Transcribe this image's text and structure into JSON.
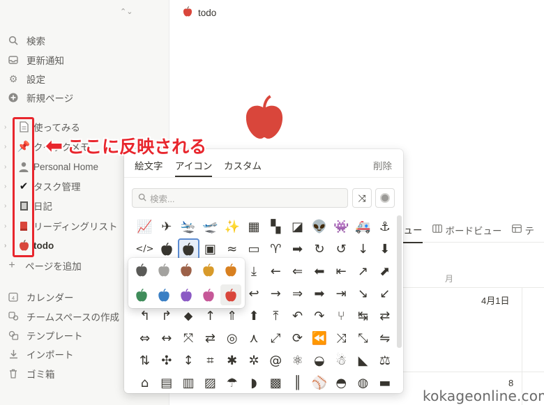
{
  "sidebar": {
    "workspace_switch_icon": "chevron-updown-icon",
    "nav": [
      {
        "label": "検索",
        "icon": "search-icon"
      },
      {
        "label": "更新通知",
        "icon": "inbox-icon"
      },
      {
        "label": "設定",
        "icon": "gear-icon"
      },
      {
        "label": "新規ページ",
        "icon": "plus-circle-icon"
      }
    ],
    "pages": [
      {
        "label": "使ってみる",
        "icon": "document-icon"
      },
      {
        "label": "クイックメモ",
        "icon": "pushpin-icon"
      },
      {
        "label": "Personal Home",
        "icon": "person-icon"
      },
      {
        "label": "タスク管理",
        "icon": "checkmark-icon"
      },
      {
        "label": "日記",
        "icon": "notebook-icon"
      },
      {
        "label": "リーディングリスト",
        "icon": "red-book-icon"
      },
      {
        "label": "todo",
        "icon": "apple-icon"
      }
    ],
    "add_page": "ページを追加",
    "footer": [
      {
        "label": "カレンダー",
        "icon": "calendar-icon"
      },
      {
        "label": "チームスペースの作成",
        "icon": "team-icon"
      },
      {
        "label": "テンプレート",
        "icon": "template-icon"
      },
      {
        "label": "インポート",
        "icon": "download-icon"
      },
      {
        "label": "ゴミ箱",
        "icon": "trash-icon"
      }
    ]
  },
  "annotation": {
    "text": "ここに反映される",
    "color": "#e8262d"
  },
  "main": {
    "breadcrumb": "todo",
    "views": [
      {
        "label": "ビュー",
        "icon": ""
      },
      {
        "label": "ボードビュー",
        "icon": "board-icon"
      },
      {
        "label": "テ",
        "icon": "table-icon"
      }
    ],
    "month_label": "月",
    "day_1": "4月1日",
    "day_8": "8"
  },
  "picker": {
    "tabs": [
      "絵文字",
      "アイコン",
      "カスタム"
    ],
    "active_tab": "アイコン",
    "delete_label": "削除",
    "search_placeholder": "検索...",
    "shuffle_icon": "shuffle-icon",
    "color_button_icon": "color-dot-icon",
    "icon_rows": [
      [
        "chart-line-icon",
        "airplane-icon",
        "landing-icon",
        "takeoff-icon",
        "sparkle-icon",
        "chart-box-icon",
        "shapes-icon",
        "map-icon",
        "alien-icon",
        "invader-icon",
        "ambulance-icon",
        "anchor-icon"
      ],
      [
        "code-icon",
        "apple-icon",
        "apple-icon",
        "luggage-icon",
        "waves-icon",
        "archive-icon",
        "aries-icon",
        "arrow-fat-icon",
        "rotate-cw-icon",
        "rotate-ccw-icon",
        "arrow-down-icon",
        "arrow-down-circle-icon"
      ],
      [
        "",
        "",
        "",
        "",
        "",
        "download-icon",
        "arrow-left-icon",
        "arrow-left-circle-icon",
        "arrow-left-bold-icon",
        "arrow-left-bar-icon",
        "arrow-up-right-icon",
        "arrow-up-right-box-icon"
      ],
      [
        "",
        "",
        "",
        "",
        "",
        "reply-icon",
        "arrow-right-icon",
        "arrow-right-circle-icon",
        "arrow-right-bold-icon",
        "arrow-right-bar-icon",
        "arrow-down-right-icon",
        "arrow-down-left-icon"
      ],
      [
        "turn-up-left-icon",
        "turn-up-right-icon",
        "diamond-arrow-icon",
        "arrow-up-icon",
        "arrow-up-circle-icon",
        "arrow-up-bold-icon",
        "arrow-up-bar-icon",
        "undo-icon",
        "redo-icon",
        "split-icon",
        "repeat-icon",
        "swap-icon"
      ],
      [
        "arrows-h-circle-icon",
        "arrows-h-icon",
        "collapse-icon",
        "arrows-lr-icon",
        "target-arrows-icon",
        "merge-icon",
        "expand-icon",
        "cycle-icon",
        "fast-back-icon",
        "shuffle-icon",
        "swap-diag-icon",
        "shuffle-2-icon"
      ],
      [
        "sort-icon",
        "arrows-circle-icon",
        "arrows-v-icon",
        "frame-icon",
        "asterisk-icon",
        "asterisk-bold-icon",
        "at-icon",
        "atom-icon",
        "avocado-icon",
        "baby-icon",
        "baby-bottle-icon",
        "abacus-icon"
      ],
      [
        "stroller-icon",
        "backpack-icon",
        "bag-icon",
        "luggage-2-icon",
        "balloon-icon",
        "banana-icon",
        "bandage-icon",
        "barcode-icon",
        "baseball-icon",
        "cap-icon",
        "basketball-icon",
        "bathtub-icon"
      ]
    ],
    "icon_glyphs": [
      [
        "📈",
        "✈",
        "🛬",
        "🛫",
        "✨",
        "▦",
        "▚",
        "◪",
        "👽",
        "👾",
        "🚑",
        "⚓"
      ],
      [
        "</>",
        "●",
        "●",
        "▣",
        "≈",
        "▭",
        "♈",
        "➡",
        "↻",
        "↺",
        "↓",
        "⬇"
      ],
      [
        "",
        "",
        "",
        "",
        "",
        "⤓",
        "←",
        "⇐",
        "⬅",
        "⇤",
        "↗",
        "⬈"
      ],
      [
        "",
        "",
        "",
        "",
        "",
        "↩",
        "→",
        "⇒",
        "➡",
        "⇥",
        "↘",
        "↙"
      ],
      [
        "↰",
        "↱",
        "⬥",
        "↑",
        "⇑",
        "⬆",
        "⤒",
        "↶",
        "↷",
        "⑂",
        "↹",
        "⇄"
      ],
      [
        "⇔",
        "↔",
        "⤧",
        "⇄",
        "◎",
        "⋏",
        "⤢",
        "⟳",
        "⏪",
        "⤨",
        "⤡",
        "⇋"
      ],
      [
        "⇅",
        "✣",
        "↕",
        "⌗",
        "✱",
        "✲",
        "@",
        "⚛",
        "◒",
        "☃",
        "◣",
        "⚖"
      ],
      [
        "⌂",
        "▤",
        "▥",
        "▨",
        "☂",
        "◗",
        "▩",
        "║",
        "⚾",
        "◓",
        "◍",
        "▬"
      ]
    ],
    "color_options": [
      {
        "name": "gray",
        "hex": "#5a5a57"
      },
      {
        "name": "light-gray",
        "hex": "#a3a29f"
      },
      {
        "name": "brown",
        "hex": "#9c6148"
      },
      {
        "name": "yellow",
        "hex": "#d89a2a"
      },
      {
        "name": "orange",
        "hex": "#d88020"
      },
      {
        "name": "green",
        "hex": "#3f8c5a"
      },
      {
        "name": "blue",
        "hex": "#3a7fc4"
      },
      {
        "name": "purple",
        "hex": "#8b5ac4"
      },
      {
        "name": "pink",
        "hex": "#c65898"
      },
      {
        "name": "red",
        "hex": "#d9463b"
      }
    ],
    "selected_color": "red",
    "accent": "#d9463b"
  },
  "watermark": "kokageonline.com"
}
